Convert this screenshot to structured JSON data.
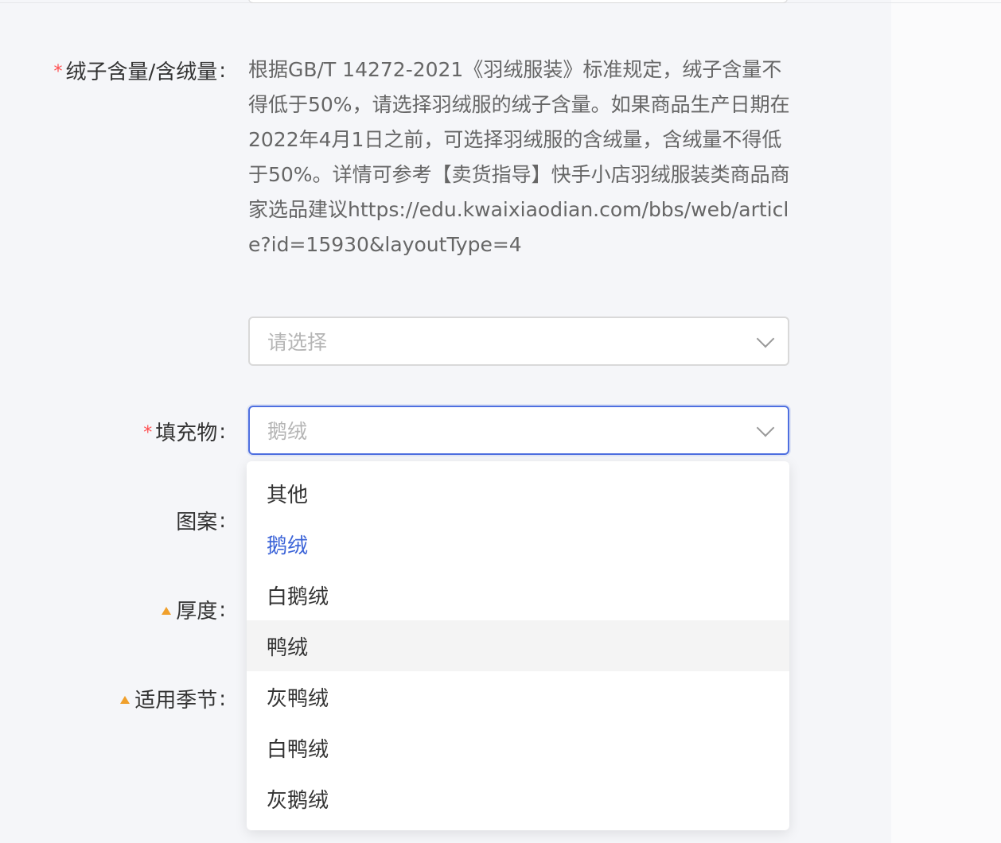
{
  "form": {
    "down_content": {
      "label": "绒子含量/含绒量",
      "colon": ":",
      "required": true,
      "help_text": "根据GB/T 14272-2021《羽绒服装》标准规定，绒子含量不得低于50%，请选择羽绒服的绒子含量。如果商品生产日期在2022年4月1日之前，可选择羽绒服的含绒量，含绒量不得低于50%。详情可参考【卖货指导】快手小店羽绒服装类商品商家选品建议https://edu.kwaixiaodian.com/bbs/web/article?id=15930&layoutType=4",
      "placeholder": "请选择"
    },
    "filling": {
      "label": "填充物",
      "colon": ":",
      "required": true,
      "value": "鹅绒"
    },
    "pattern": {
      "label": "图案",
      "colon": ":"
    },
    "thickness": {
      "label": "厚度",
      "colon": ":",
      "recommended": true
    },
    "season": {
      "label": "适用季节",
      "colon": ":",
      "recommended": true
    }
  },
  "dropdown": {
    "options": [
      "其他",
      "鹅绒",
      "白鹅绒",
      "鸭绒",
      "灰鸭绒",
      "白鸭绒",
      "灰鹅绒"
    ],
    "selected": "鹅绒",
    "hovered": "鸭绒"
  },
  "colors": {
    "accent": "#3c64d8",
    "required_star": "#ff4d4f",
    "recommend_triangle": "#f0a02c",
    "focus_border": "#4e6fe0"
  },
  "required_mark": "*"
}
